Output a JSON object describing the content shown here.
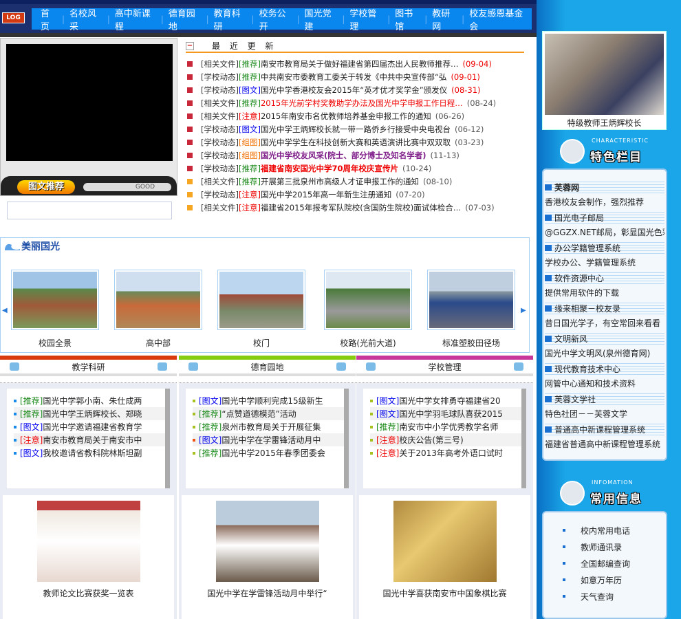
{
  "header": {
    "logo": "LOG",
    "nav": [
      "首页",
      "名校风采",
      "高中新课程",
      "德育园地",
      "教育科研",
      "校务公开",
      "国光党建",
      "学校管理",
      "图书馆",
      "教研网",
      "校友感恩基金会"
    ]
  },
  "feature_box": {
    "tab_label": "图文推荐",
    "good_label": "GOOD"
  },
  "news": {
    "title": "最 近 更 新",
    "items": [
      {
        "cat": "[相关文件]",
        "tag": "[推荐]",
        "tc": "g",
        "text": "南安市教育局关于做好福建省第四届杰出人民教师推荐…",
        "date": "(09-04)",
        "dc": "red",
        "bul": "red",
        "style": ""
      },
      {
        "cat": "[学校动态]",
        "tag": "[推荐]",
        "tc": "g",
        "text": "中共南安市委教育工委关于转发《中共中央宣传部“弘",
        "date": "(09-01)",
        "dc": "red",
        "bul": "red",
        "style": ""
      },
      {
        "cat": "[学校动态]",
        "tag": "[图文]",
        "tc": "b",
        "text": "国光中学香港校友会2015年“英才优才奖学金”颁发仪",
        "date": "(08-31)",
        "dc": "red",
        "bul": "red",
        "style": ""
      },
      {
        "cat": "[相关文件]",
        "tag": "[推荐]",
        "tc": "g",
        "text": "2015年光前学村奖教助学办法及国光中学申报工作日程…",
        "date": "(08-24)",
        "dc": "",
        "bul": "red",
        "style": "red"
      },
      {
        "cat": "[相关文件]",
        "tag": "[注意]",
        "tc": "r",
        "text": "2015年南安市名优教师培养基金申报工作的通知",
        "date": "(06-26)",
        "dc": "",
        "bul": "red",
        "style": ""
      },
      {
        "cat": "[学校动态]",
        "tag": "[图文]",
        "tc": "b",
        "text": "国光中学王炳辉校长就一带一路侨乡行接受中央电视台",
        "date": "(06-12)",
        "dc": "",
        "bul": "red",
        "style": ""
      },
      {
        "cat": "[学校动态]",
        "tag": "[组图]",
        "tc": "o",
        "text": "国光中学学生在科技创新大赛和英语演讲比赛中双双取",
        "date": "(03-23)",
        "dc": "",
        "bul": "red",
        "style": ""
      },
      {
        "cat": "[学校动态]",
        "tag": "[组图]",
        "tc": "o",
        "text": "国光中学校友风采(院士、部分博士及知名学者)",
        "date": "(11-13)",
        "dc": "",
        "bul": "red",
        "style": "purple"
      },
      {
        "cat": "[学校动态]",
        "tag": "[推荐]",
        "tc": "g",
        "text": "福建省南安国光中学70周年校庆宣传片",
        "date": "(10-24)",
        "dc": "",
        "bul": "red",
        "style": "redbold"
      },
      {
        "cat": "[相关文件]",
        "tag": "[推荐]",
        "tc": "g",
        "text": "开展第三批泉州市高级人才证申报工作的通知",
        "date": "(08-10)",
        "dc": "",
        "bul": "org",
        "style": ""
      },
      {
        "cat": "[学校动态]",
        "tag": "[注意]",
        "tc": "r",
        "text": "国光中学2015年高一年新生注册通知",
        "date": "(07-20)",
        "dc": "",
        "bul": "org",
        "style": ""
      },
      {
        "cat": "[相关文件]",
        "tag": "[注意]",
        "tc": "r",
        "text": "福建省2015年报考军队院校(含国防生院校)面试体检合…",
        "date": "(07-03)",
        "dc": "",
        "bul": "org",
        "style": ""
      }
    ]
  },
  "scenery": {
    "title": "美丽国光",
    "items": [
      "校园全景",
      "高中部",
      "校门",
      "校路(光前大道)",
      "标准塑胶田径场"
    ]
  },
  "columns": [
    {
      "title": "教学科研",
      "color": "#d93a0e",
      "items": [
        {
          "tag": "[推荐]",
          "tc": "g",
          "text": "国光中学郭小南、朱仕成两"
        },
        {
          "tag": "[推荐]",
          "tc": "g",
          "text": "国光中学王炳辉校长、郑晓"
        },
        {
          "tag": "[图文]",
          "tc": "b",
          "text": "国光中学邀请福建省教育学"
        },
        {
          "tag": "[注意]",
          "tc": "r",
          "text": "南安市教育局关于南安市中"
        },
        {
          "tag": "[图文]",
          "tc": "b",
          "text": "我校邀请省教科院林斯坦副"
        }
      ],
      "pic_caption": "教师论文比赛获奖一览表"
    },
    {
      "title": "德育园地",
      "color": "#86cc10",
      "items": [
        {
          "tag": "[图文]",
          "tc": "b",
          "text": "国光中学顺利完成15级新生"
        },
        {
          "tag": "[推荐]",
          "tc": "g",
          "text": "“点赞道德模范”活动"
        },
        {
          "tag": "[推荐]",
          "tc": "g",
          "text": "泉州市教育局关于开展征集"
        },
        {
          "tag": "[图文]",
          "tc": "b",
          "text": "国光中学在学雷锋活动月中"
        },
        {
          "tag": "[推荐]",
          "tc": "g",
          "text": "国光中学2015年春季团委会"
        }
      ],
      "pic_caption": "国光中学在学雷锋活动月中举行“"
    },
    {
      "title": "学校管理",
      "color": "#c8389a",
      "items": [
        {
          "tag": "[图文]",
          "tc": "b",
          "text": "国光中学女排勇夺福建省20"
        },
        {
          "tag": "[图文]",
          "tc": "b",
          "text": "国光中学羽毛球队喜获2015"
        },
        {
          "tag": "[推荐]",
          "tc": "g",
          "text": "南安市中小学优秀教学名师"
        },
        {
          "tag": "[注意]",
          "tc": "r",
          "text": "校庆公告(第三号)"
        },
        {
          "tag": "[注意]",
          "tc": "r",
          "text": "关于2013年高考外语口试时"
        }
      ],
      "pic_caption": "国光中学喜获南安市中国象棋比赛"
    }
  ],
  "sidebar": {
    "photo_caption": "特级教师王炳辉校长",
    "featured": {
      "en": "CHARACTERISTIC",
      "cn": "特色栏目",
      "items": [
        {
          "title": "芙蓉网",
          "desc": "香港校友会制作，强烈推荐"
        },
        {
          "title": "国光电子邮局",
          "desc": "@GGZX.NET邮局，彰显国光色彩"
        },
        {
          "title": "办公学籍管理系统",
          "desc": "学校办公、学籍管理系统"
        },
        {
          "title": "软件资源中心",
          "desc": "提供常用软件的下载"
        },
        {
          "title": "缘来相聚－校友录",
          "desc": "昔日国光学子，有空常回来看看"
        },
        {
          "title": "文明新风",
          "desc": "国光中学文明风(泉州德育网)"
        },
        {
          "title": "现代教育技术中心",
          "desc": "网管中心通知和技术资料"
        },
        {
          "title": "芙蓉文学社",
          "desc": "特色社团－－芙蓉文学"
        },
        {
          "title": "普通高中新课程管理系统",
          "desc": "福建省普通高中新课程管理系统"
        }
      ]
    },
    "info": {
      "en": "INFOMATION",
      "cn": "常用信息",
      "items": [
        "校内常用电话",
        "教师通讯录",
        "全国邮编查询",
        "如意万年历",
        "天气查询"
      ]
    }
  }
}
